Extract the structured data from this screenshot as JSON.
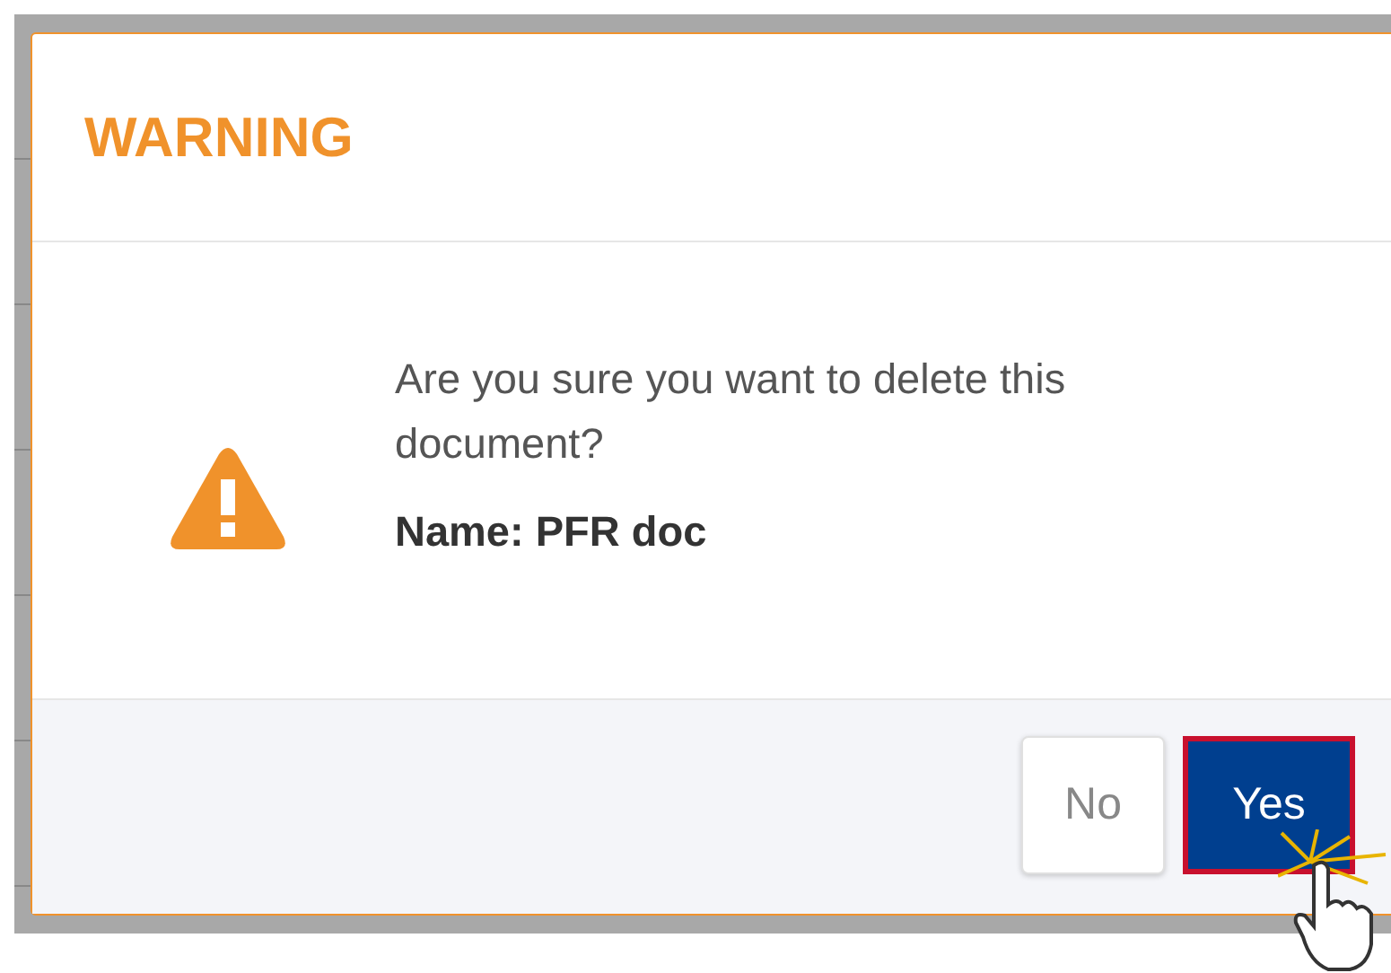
{
  "dialog": {
    "title": "WARNING",
    "message": "Are you sure you want to delete this document?",
    "detail": "Name: PFR doc",
    "buttons": [
      {
        "label": "No",
        "kind": "secondary",
        "focused": false
      },
      {
        "label": "Yes",
        "kind": "primary",
        "focused": true
      }
    ]
  }
}
